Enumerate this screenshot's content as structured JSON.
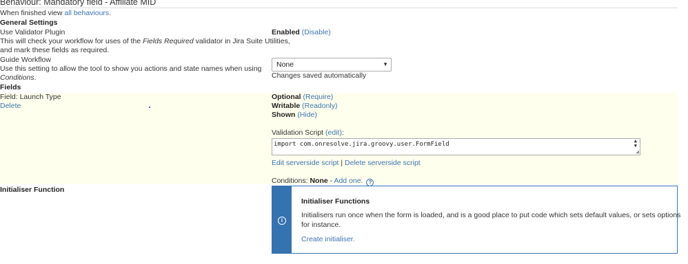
{
  "page": {
    "title": "Behaviour: Mandatory field - Affiliate MID",
    "finished_prefix": "When finished view ",
    "finished_link": "all behaviours",
    "finished_suffix": "."
  },
  "general_settings": {
    "heading": "General Settings",
    "validator": {
      "label": "Use Validator Plugin",
      "desc_part1": "This will check your workflow for uses of the ",
      "desc_em": "Fields Required",
      "desc_part2": " validator in Jira Suite Utilities,",
      "desc_line2": "and mark these fields as required.",
      "status": "Enabled",
      "action_link": "(Disable)"
    },
    "guide": {
      "label": "Guide Workflow",
      "desc_line1": "Use this setting to allow the tool to show you actions and state names when using",
      "desc_em": "Conditions",
      "desc_suffix": ".",
      "select_value": "None",
      "saved_note": "Changes saved automatically"
    }
  },
  "fields": {
    "heading": "Fields",
    "field_label": "Field: Launch Type",
    "delete_link": "Delete",
    "optional": {
      "text": "Optional",
      "link": "(Require)"
    },
    "writable": {
      "text": "Writable",
      "link": "(Readonly)"
    },
    "shown": {
      "text": "Shown",
      "link": "(Hide)"
    },
    "validation_label": "Validation Script ",
    "validation_edit": "(edit)",
    "validation_colon": ":",
    "validation_code": "import com.onresolve.jira.groovy.user.FormField",
    "edit_serverside": "Edit serverside script",
    "separator": " | ",
    "delete_serverside": "Delete serverside script",
    "conditions_label": "Conditions: ",
    "conditions_value": "None",
    "conditions_dash": " - ",
    "add_one": "Add one.",
    "help_glyph": "?"
  },
  "initialiser": {
    "label": "Initialiser Function",
    "panel_title": "Initialiser Functions",
    "panel_text_line1": "Initialisers run once when the form is loaded, and is a good place to put code which sets default values, or sets options",
    "panel_text_line2": "for instance.",
    "create_link": "Create initialiser.",
    "info_glyph": "i"
  },
  "colors": {
    "link": "#3b73af",
    "band": "#ffffee",
    "panel_accent": "#3572b0"
  }
}
